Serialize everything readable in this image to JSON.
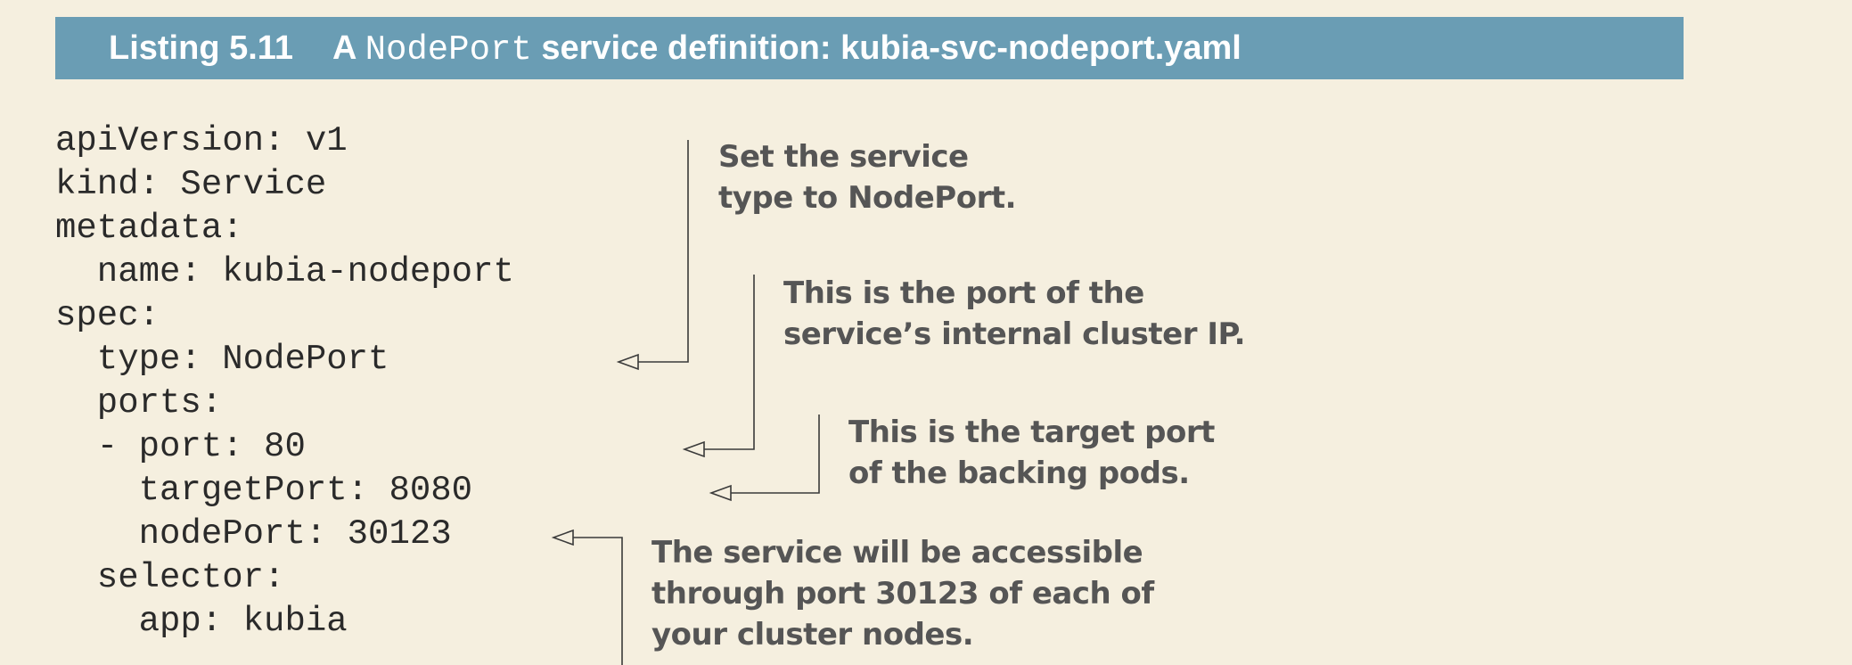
{
  "header": {
    "listing_number": "Listing 5.11",
    "title_prefix": "A ",
    "title_mono": "NodePort",
    "title_suffix": " service definition: kubia-svc-nodeport.yaml"
  },
  "code_lines": [
    "apiVersion: v1",
    "kind: Service",
    "metadata:",
    "  name: kubia-nodeport",
    "spec:",
    "  type: NodePort",
    "  ports:",
    "  - port: 80",
    "    targetPort: 8080",
    "    nodePort: 30123",
    "  selector:",
    "    app: kubia"
  ],
  "annotations": [
    {
      "lines": [
        "Set the service",
        "type to NodePort."
      ]
    },
    {
      "lines": [
        "This is the port of the",
        "service’s internal cluster IP."
      ]
    },
    {
      "lines": [
        "This is the target port",
        "of the backing pods."
      ]
    },
    {
      "lines": [
        "The service will be accessible",
        "through port 30123 of each of",
        "your cluster nodes."
      ]
    }
  ],
  "colors": {
    "background": "#f5efdf",
    "header_bar": "#6a9db4",
    "annotation_text": "#555555",
    "code_text": "#2a2a2a"
  }
}
